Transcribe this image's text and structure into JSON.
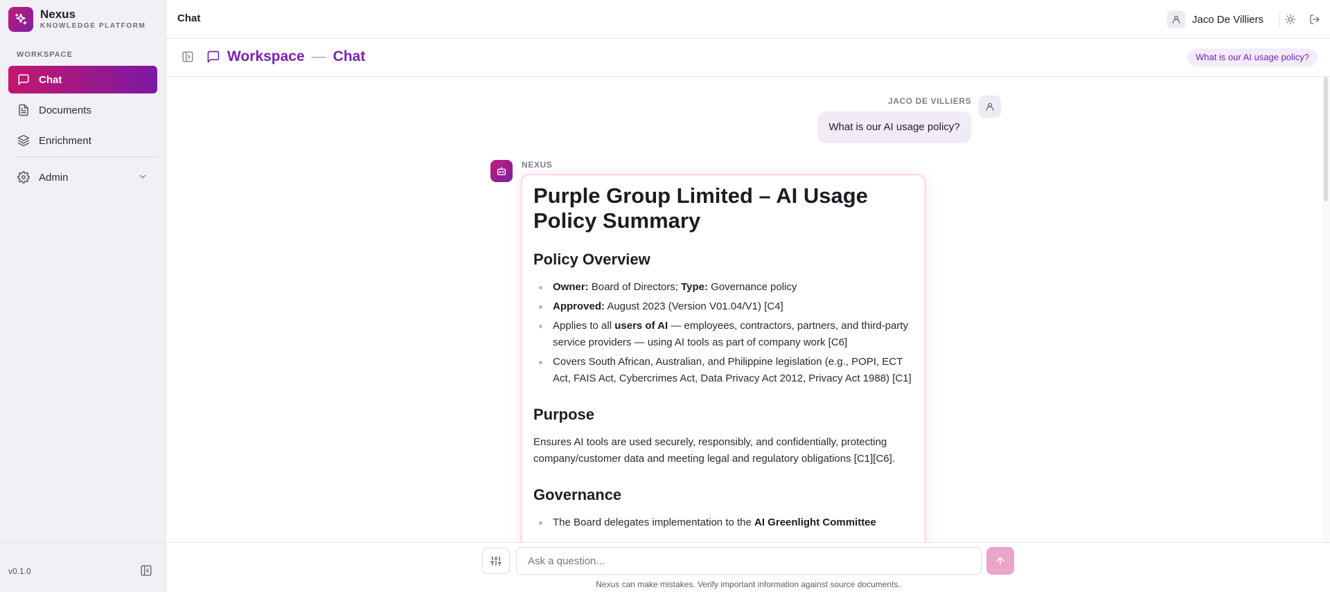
{
  "brand": {
    "name": "Nexus",
    "subtitle": "KNOWLEDGE PLATFORM"
  },
  "sidebar": {
    "section_label": "WORKSPACE",
    "items": [
      {
        "label": "Chat",
        "icon": "chat-icon",
        "active": true
      },
      {
        "label": "Documents",
        "icon": "document-icon",
        "active": false
      },
      {
        "label": "Enrichment",
        "icon": "layers-icon",
        "active": false
      },
      {
        "label": "Admin",
        "icon": "gear-icon",
        "active": false
      }
    ],
    "version": "v0.1.0"
  },
  "header": {
    "title": "Chat",
    "user_name": "Jaco De Villiers"
  },
  "subheader": {
    "breadcrumb_workspace": "Workspace",
    "breadcrumb_separator": "—",
    "breadcrumb_page": "Chat",
    "suggestion_pill": "What is our AI usage policy?"
  },
  "conversation": {
    "user_label": "JACO DE VILLIERS",
    "user_message": "What is our AI usage policy?",
    "bot_label": "NEXUS",
    "answer": {
      "title": "Purple Group Limited – AI Usage Policy Summary",
      "overview_heading": "Policy Overview",
      "overview_items": [
        {
          "b1": "Owner:",
          "t1": " Board of Directors; ",
          "b2": "Type:",
          "t2": " Governance policy"
        },
        {
          "b1": "Approved:",
          "t1": " August 2023 (Version V01.04/V1) [C4]",
          "b2": "",
          "t2": ""
        },
        {
          "b1": "",
          "t1": "Applies to all ",
          "b2": "users of AI",
          "t2": " — employees, contractors, partners, and third-party service providers — using AI tools as part of company work [C6]"
        },
        {
          "b1": "",
          "t1": "Covers South African, Australian, and Philippine legislation (e.g., POPI, ECT Act, FAIS Act, Cybercrimes Act, Data Privacy Act 2012, Privacy Act 1988) [C1]",
          "b2": "",
          "t2": ""
        }
      ],
      "purpose_heading": "Purpose",
      "purpose_text": "Ensures AI tools are used securely, responsibly, and confidentially, protecting company/customer data and meeting legal and regulatory obligations [C1][C6].",
      "governance_heading": "Governance",
      "governance_items": [
        {
          "t1": "The Board delegates implementation to the ",
          "b1": "AI Greenlight Committee"
        }
      ]
    }
  },
  "composer": {
    "placeholder": "Ask a question...",
    "disclaimer": "Nexus can make mistakes. Verify important information against source documents."
  },
  "colors": {
    "accent": "#7a22b0",
    "brand_gradient_start": "#c3176d",
    "brand_gradient_end": "#7b1aa4",
    "send_button": "#e9a6c9"
  }
}
